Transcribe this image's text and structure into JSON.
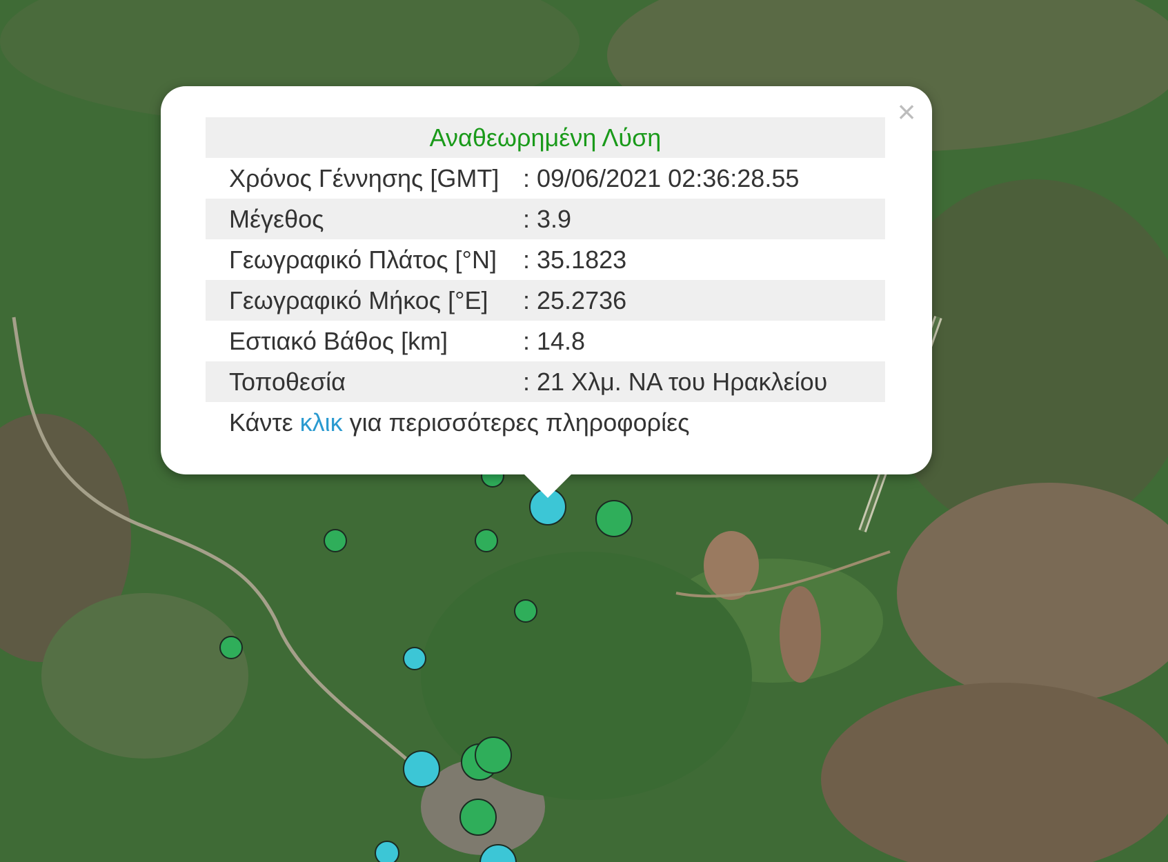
{
  "popup": {
    "title": "Αναθεωρημένη Λύση",
    "close_label": "×",
    "rows": [
      {
        "label": "Χρόνος Γέννησης [GMT]",
        "value": ": 09/06/2021 02:36:28.55"
      },
      {
        "label": "Μέγεθος",
        "value": ": 3.9"
      },
      {
        "label": "Γεωγραφικό Πλάτος [°N]",
        "value": ": 35.1823"
      },
      {
        "label": "Γεωγραφικό Μήκος [°E]",
        "value": ": 25.2736"
      },
      {
        "label": "Εστιακό Βάθος [km]",
        "value": ": 14.8"
      },
      {
        "label": "Τοποθεσία",
        "value": ": 21 Χλμ. ΝΑ του Ηρακλείου"
      }
    ],
    "footer_prefix": "Κάντε ",
    "footer_link": "κλικ",
    "footer_suffix": " για περισσότερες πληροφορίες"
  },
  "colors": {
    "marker_green": "#2fae5a",
    "marker_cyan": "#3cc6d6",
    "title_green": "#1a9a1a",
    "link_blue": "#2a9ad0"
  }
}
